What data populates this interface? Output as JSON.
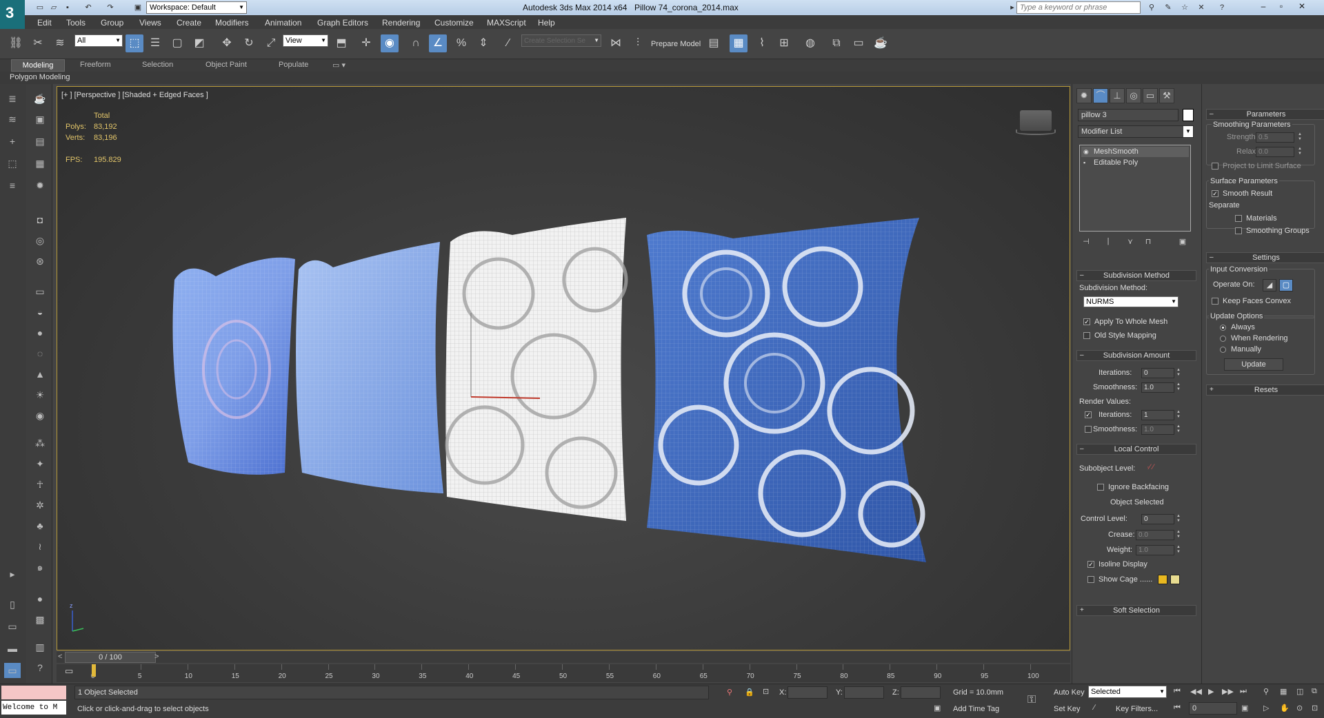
{
  "titlebar": {
    "workspace": "Workspace: Default",
    "app_title": "Autodesk 3ds Max  2014 x64",
    "file_title": "Pillow 74_corona_2014.max",
    "search_placeholder": "Type a keyword or phrase"
  },
  "menu": [
    "Edit",
    "Tools",
    "Group",
    "Views",
    "Create",
    "Modifiers",
    "Animation",
    "Graph Editors",
    "Rendering",
    "Customize",
    "MAXScript",
    "Help"
  ],
  "toolbar": {
    "filter": "All",
    "ref_coord": "View",
    "selection_set": "Create Selection Se",
    "prepare_model": "Prepare Model"
  },
  "ribbon": {
    "tabs": [
      "Modeling",
      "Freeform",
      "Selection",
      "Object Paint",
      "Populate"
    ],
    "active_tab": "Modeling",
    "panel": "Polygon Modeling"
  },
  "viewport": {
    "label": "[+ ] [Perspective ] [Shaded + Edged Faces ]",
    "stats": {
      "total_label": "Total",
      "polys_label": "Polys:",
      "polys": "83,192",
      "verts_label": "Verts:",
      "verts": "83,196",
      "fps_label": "FPS:",
      "fps": "195.829"
    },
    "axis_label": "z"
  },
  "timeline": {
    "slider": "0 / 100",
    "ticks": [
      "0",
      "5",
      "10",
      "15",
      "20",
      "25",
      "30",
      "35",
      "40",
      "45",
      "50",
      "55",
      "60",
      "65",
      "70",
      "75",
      "80",
      "85",
      "90",
      "95",
      "100"
    ]
  },
  "status": {
    "maxscript": "Welcome to M",
    "selection": "1 Object Selected",
    "prompt": "Click or click-and-drag to select objects",
    "x_label": "X:",
    "y_label": "Y:",
    "z_label": "Z:",
    "grid": "Grid = 10.0mm",
    "add_time_tag": "Add Time Tag",
    "auto_key": "Auto Key",
    "set_key": "Set Key",
    "key_mode": "Selected",
    "key_filters": "Key Filters...",
    "frame": "0"
  },
  "command_panel": {
    "object_name": "pillow 3",
    "modifier_list": "Modifier List",
    "stack": [
      "MeshSmooth",
      "Editable Poly"
    ],
    "subdivision_method": {
      "title": "Subdivision Method",
      "method_label": "Subdivision Method:",
      "method": "NURMS",
      "apply_whole_mesh": "Apply To Whole Mesh",
      "old_style": "Old Style Mapping"
    },
    "subdivision_amount": {
      "title": "Subdivision Amount",
      "iterations_label": "Iterations:",
      "iterations": "0",
      "smoothness_label": "Smoothness:",
      "smoothness": "1.0",
      "render_values": "Render Values:",
      "r_iterations_label": "Iterations:",
      "r_iterations": "1",
      "r_smoothness_label": "Smoothness:",
      "r_smoothness": "1.0"
    },
    "local_control": {
      "title": "Local Control",
      "subobject_level": "Subobject Level:",
      "ignore_backfacing": "Ignore Backfacing",
      "object_selected": "Object Selected",
      "control_level_label": "Control Level:",
      "control_level": "0",
      "crease_label": "Crease:",
      "crease": "0.0",
      "weight_label": "Weight:",
      "weight": "1.0",
      "isoline": "Isoline Display",
      "show_cage": "Show Cage ......",
      "cage_color1": "#e8b820",
      "cage_color2": "#e8dc90"
    },
    "soft_selection": "Soft Selection"
  },
  "right_panel": {
    "parameters": "Parameters",
    "smoothing_parameters": "Smoothing Parameters",
    "strength_label": "Strength:",
    "strength": "0.5",
    "relax_label": "Relax:",
    "relax": "0.0",
    "project_limit": "Project to Limit Surface",
    "surface_parameters": "Surface Parameters",
    "smooth_result": "Smooth Result",
    "separate": "Separate",
    "materials": "Materials",
    "smoothing_groups": "Smoothing Groups",
    "settings": "Settings",
    "input_conversion": "Input Conversion",
    "operate_on": "Operate On:",
    "keep_faces_convex": "Keep Faces Convex",
    "update_options": "Update Options",
    "always": "Always",
    "when_rendering": "When Rendering",
    "manually": "Manually",
    "update": "Update",
    "resets": "Resets"
  },
  "colors": {
    "accent": "#5a8bc4",
    "viewport_border": "#b89a3a",
    "stats_text": "#e3c66a"
  }
}
